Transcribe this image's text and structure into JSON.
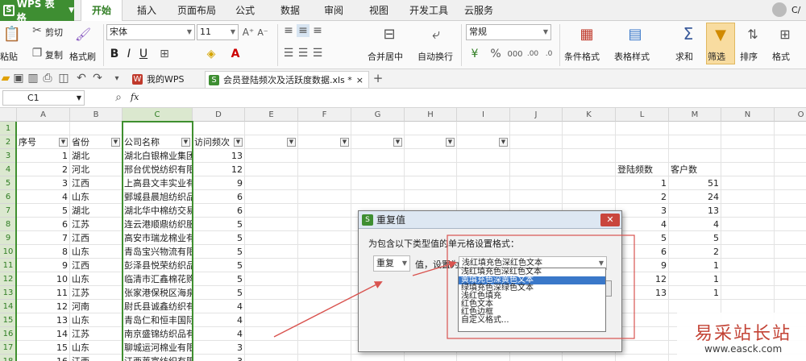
{
  "app": {
    "name": "WPS 表格",
    "user": "C/"
  },
  "menus": [
    "开始",
    "插入",
    "页面布局",
    "公式",
    "数据",
    "审阅",
    "视图",
    "开发工具",
    "云服务"
  ],
  "ribbon": {
    "paste": "粘贴",
    "cut": "剪切",
    "copy": "复制",
    "format_painter": "格式刷",
    "font_name": "宋体",
    "font_size": "11",
    "merge_center": "合并居中",
    "auto_wrap": "自动换行",
    "number_format": "常规",
    "cond_format": "条件格式",
    "table_style": "表格样式",
    "sum": "求和",
    "filter": "筛选",
    "sort": "排序",
    "format": "格式"
  },
  "doc_tabs": [
    {
      "label": "我的WPS"
    },
    {
      "label": "会员登陆频次及活跃度数据.xls *"
    }
  ],
  "formula_bar": {
    "name_box": "C1",
    "fx": "fx",
    "content": ""
  },
  "columns": [
    "A",
    "B",
    "C",
    "D",
    "E",
    "F",
    "G",
    "H",
    "I",
    "J",
    "K",
    "L",
    "M",
    "N",
    "O"
  ],
  "row_numbers": [
    "1",
    "2",
    "3",
    "4",
    "5",
    "6",
    "7",
    "8",
    "9",
    "10",
    "11",
    "12",
    "13",
    "14",
    "15",
    "16",
    "17",
    "18"
  ],
  "headers": {
    "a": "序号",
    "b": "省份",
    "c": "公司名称",
    "d": "访问频次"
  },
  "rows": [
    {
      "a": "1",
      "b": "湖北",
      "c": "湖北白银棉业集团",
      "d": "13"
    },
    {
      "a": "2",
      "b": "河北",
      "c": "邢台优悦纺织有限",
      "d": "12"
    },
    {
      "a": "3",
      "b": "江西",
      "c": "上高县文丰实业有",
      "d": "9"
    },
    {
      "a": "4",
      "b": "山东",
      "c": "鄄城县晨旭纺织品",
      "d": "6"
    },
    {
      "a": "5",
      "b": "湖北",
      "c": "湖北华中棉纺交易",
      "d": "6"
    },
    {
      "a": "6",
      "b": "江苏",
      "c": "连云港顺鼎纺织服",
      "d": "5"
    },
    {
      "a": "7",
      "b": "江西",
      "c": "高安市瑞龙棉业有",
      "d": "5"
    },
    {
      "a": "8",
      "b": "山东",
      "c": "青岛宝兴物流有限",
      "d": "5"
    },
    {
      "a": "9",
      "b": "江西",
      "c": "彭泽县悦荣纺织品",
      "d": "5"
    },
    {
      "a": "10",
      "b": "山东",
      "c": "临清市汇鑫棉花购",
      "d": "5"
    },
    {
      "a": "11",
      "b": "江苏",
      "c": "张家港保税区海泉",
      "d": "5"
    },
    {
      "a": "12",
      "b": "河南",
      "c": "尉氏县诚鑫纺织有",
      "d": "4"
    },
    {
      "a": "13",
      "b": "山东",
      "c": "青岛仁和恒丰国际",
      "d": "4"
    },
    {
      "a": "14",
      "b": "江苏",
      "c": "南京盛锦纺织品有",
      "d": "4"
    },
    {
      "a": "15",
      "b": "山东",
      "c": "聊城运河棉业有限",
      "d": "3"
    },
    {
      "a": "16",
      "b": "江西",
      "c": "江西莱富纺织有限",
      "d": "3"
    }
  ],
  "side_table": {
    "header_l": "登陆频数",
    "header_m": "客户数",
    "rows": [
      [
        "1",
        "51"
      ],
      [
        "2",
        "24"
      ],
      [
        "3",
        "13"
      ],
      [
        "4",
        "4"
      ],
      [
        "5",
        "5"
      ],
      [
        "6",
        "2"
      ],
      [
        "9",
        "1"
      ],
      [
        "12",
        "1"
      ],
      [
        "13",
        "1"
      ]
    ]
  },
  "dialog": {
    "title": "重复值",
    "instruction": "为包含以下类型值的单元格设置格式：",
    "rule_value": "重复",
    "set_as": "值，设置为",
    "selected_style": "浅红填充色深红色文本",
    "options": [
      "浅红填充色深红色文本",
      "黄填充色深黄色文本",
      "绿填充色深绿色文本",
      "浅红色填充",
      "红色文本",
      "红色边框",
      "自定义格式..."
    ]
  },
  "watermark": {
    "line1": "易采站长站",
    "line2": "www.easck.com"
  },
  "colors": {
    "brand": "#3e8e32",
    "selection": "#3f8f2f",
    "arrow": "#d9534f",
    "highlight": "#3a78c9"
  }
}
